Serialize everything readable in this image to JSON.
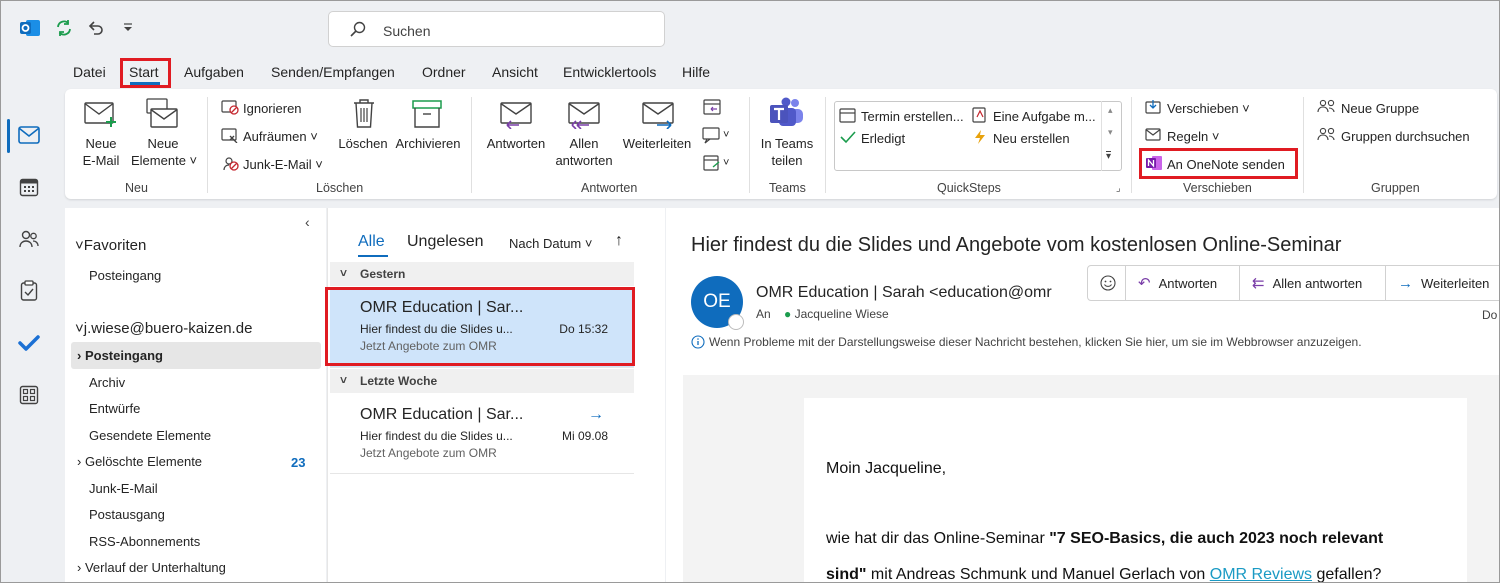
{
  "title_bar": {
    "search_placeholder": "Suchen",
    "icons": [
      "outlook-logo-icon",
      "sync-icon",
      "undo-icon",
      "customize-dropdown-icon"
    ]
  },
  "rail": {
    "items": [
      "mail-icon",
      "calendar-icon",
      "people-icon",
      "tasks-icon",
      "todo-icon",
      "apps-icon"
    ]
  },
  "menu_tabs": [
    "Datei",
    "Start",
    "Aufgaben",
    "Senden/Empfangen",
    "Ordner",
    "Ansicht",
    "Entwicklertools",
    "Hilfe"
  ],
  "active_tab": "Start",
  "ribbon": {
    "neu": {
      "label": "Neu",
      "neue_email_1": "Neue",
      "neue_email_2": "E-Mail",
      "neue_elemente_1": "Neue",
      "neue_elemente_2": "Elemente"
    },
    "loeschen": {
      "label": "Löschen",
      "ignorieren": "Ignorieren",
      "aufraeumen": "Aufräumen",
      "junk": "Junk-E-Mail",
      "loeschen_btn": "Löschen",
      "archivieren": "Archivieren"
    },
    "antworten": {
      "label": "Antworten",
      "antworten_btn": "Antworten",
      "allen_1": "Allen",
      "allen_2": "antworten",
      "weiterleiten": "Weiterleiten"
    },
    "teams": {
      "label": "Teams",
      "btn_1": "In Teams",
      "btn_2": "teilen"
    },
    "quicksteps": {
      "label": "QuickSteps",
      "termin": "Termin erstellen...",
      "aufgabe": "Eine Aufgabe m...",
      "erledigt": "Erledigt",
      "neu_erstellen": "Neu erstellen"
    },
    "verschieben": {
      "label": "Verschieben",
      "verschieben_btn": "Verschieben",
      "regeln": "Regeln",
      "onenote": "An OneNote senden"
    },
    "gruppen": {
      "label": "Gruppen",
      "neue_gruppe": "Neue Gruppe",
      "durchsuchen": "Gruppen durchsuchen"
    }
  },
  "folders": {
    "favoriten": "Favoriten",
    "fav_posteingang": "Posteingang",
    "account": "j.wiese@buero-kaizen.de",
    "items": [
      {
        "name": "Posteingang",
        "selected": true
      },
      {
        "name": "Archiv"
      },
      {
        "name": "Entwürfe"
      },
      {
        "name": "Gesendete Elemente"
      },
      {
        "name": "Gelöschte Elemente",
        "count": "23"
      },
      {
        "name": "Junk-E-Mail"
      },
      {
        "name": "Postausgang"
      },
      {
        "name": "RSS-Abonnements"
      },
      {
        "name": "Verlauf der Unterhaltung"
      }
    ]
  },
  "mail_list": {
    "filter_all": "Alle",
    "filter_unread": "Ungelesen",
    "sort": "Nach Datum",
    "groups": [
      {
        "header": "Gestern",
        "from": "OMR Education | Sar...",
        "subject": "Hier findest du die Slides u...",
        "date": "Do 15:32",
        "preview": "Jetzt Angebote zum OMR",
        "selected": true
      },
      {
        "header": "Letzte Woche",
        "from": "OMR Education | Sar...",
        "subject": "Hier findest du die Slides u...",
        "date": "Mi 09.08",
        "preview": "Jetzt Angebote zum OMR",
        "forwarded": true
      }
    ]
  },
  "reading": {
    "subject": "Hier findest du die Slides und Angebote vom kostenlosen Online-Seminar",
    "avatar": "OE",
    "sender": "OMR Education | Sarah <education@omr",
    "to_label": "An",
    "to_name": "Jacqueline Wiese",
    "date_cut": "Do",
    "actions": {
      "antworten": "Antworten",
      "allen": "Allen antworten",
      "weiterleiten": "Weiterleiten"
    },
    "info": "Wenn Probleme mit der Darstellungsweise dieser Nachricht bestehen, klicken Sie hier, um sie im Webbrowser anzuzeigen.",
    "body": {
      "greeting": "Moin Jacqueline,",
      "p1_a": "wie hat dir das Online-Seminar ",
      "p1_b": "\"7 SEO-Basics, die auch 2023 noch relevant",
      "p2_a": "sind\"",
      "p2_b": " mit Andreas Schmunk und Manuel Gerlach von ",
      "p2_link": "OMR Reviews",
      "p2_c": " gefallen?"
    }
  },
  "colors": {
    "accent": "#0f6cbd",
    "highlight": "#e01b22",
    "selected_mail": "#cfe4fa",
    "link": "#1a9ac4"
  }
}
